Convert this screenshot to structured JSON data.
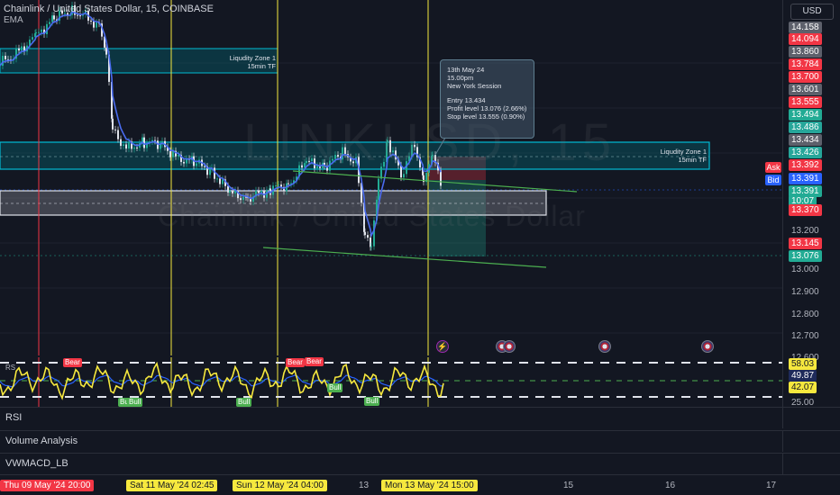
{
  "header": {
    "title": "Chainlink / United States Dollar, 15, COINBASE",
    "ema_label": "EMA"
  },
  "watermark": {
    "symbol": "LINKUSD, 15",
    "name": "Chainlink / United States Dollar"
  },
  "zones": [
    {
      "label_line1": "Liqudity Zone 1",
      "label_line2": "15min TF"
    },
    {
      "label_line1": "Liqudity Zone 1",
      "label_line2": "15min TF"
    }
  ],
  "trade_note": {
    "date": "13th May 24",
    "time": "15.00pm",
    "session": "New York Session",
    "entry": "Entry 13.434",
    "profit": "Profit level 13.076 (2.66%)",
    "stop": "Stop level 13.555 (0.90%)"
  },
  "price_axis": {
    "currency": "USD",
    "ask_label": "Ask",
    "bid_label": "Bid",
    "labels": [
      {
        "text": "14.158",
        "style": "gray"
      },
      {
        "text": "14.094",
        "style": "red"
      },
      {
        "text": "13.860",
        "style": "gray"
      },
      {
        "text": "13.784",
        "style": "red"
      },
      {
        "text": "13.700",
        "style": "red"
      },
      {
        "text": "13.601",
        "style": "gray"
      },
      {
        "text": "13.555",
        "style": "red"
      },
      {
        "text": "13.494",
        "style": "green"
      },
      {
        "text": "13.486",
        "style": "teal"
      },
      {
        "text": "13.434",
        "style": "gray"
      },
      {
        "text": "13.426",
        "style": "teal"
      },
      {
        "text": "13.392",
        "style": "red"
      },
      {
        "text": "13.391",
        "style": "blue"
      },
      {
        "text": "13.391",
        "style": "green"
      },
      {
        "text": "10:07",
        "style": "green"
      },
      {
        "text": "13.370",
        "style": "red"
      },
      {
        "text": "13.200",
        "style": "plain"
      },
      {
        "text": "13.145",
        "style": "red"
      },
      {
        "text": "13.076",
        "style": "green"
      },
      {
        "text": "13.000",
        "style": "plain"
      },
      {
        "text": "12.900",
        "style": "plain"
      },
      {
        "text": "12.800",
        "style": "plain"
      },
      {
        "text": "12.700",
        "style": "plain"
      },
      {
        "text": "12.600",
        "style": "plain"
      },
      {
        "text": "58.03",
        "style": "yellow"
      },
      {
        "text": "49.87",
        "style": "navy"
      },
      {
        "text": "42.07",
        "style": "yellow"
      },
      {
        "text": "25.00",
        "style": "plain"
      }
    ]
  },
  "indicator": {
    "short_label": "RS",
    "bear_label": "Bear",
    "bull_label": "Bull"
  },
  "panels": [
    "RSI",
    "Volume Analysis",
    "VWMACD_LB"
  ],
  "time_axis": [
    {
      "text": "Thu 09 May '24   20:00",
      "style": "red"
    },
    {
      "text": "Sat 11 May '24   02:45",
      "style": "hl"
    },
    {
      "text": "Sun 12 May '24   04:00",
      "style": "hl"
    },
    {
      "text": "13",
      "style": "plain"
    },
    {
      "text": "Mon 13 May '24   15:00",
      "style": "hl"
    },
    {
      "text": "15",
      "style": "plain"
    },
    {
      "text": "16",
      "style": "plain"
    },
    {
      "text": "17",
      "style": "plain"
    }
  ],
  "colors": {
    "background": "#131722",
    "zone_border": "#00bcd4",
    "zone_fill": "#006d7a",
    "green_label": "#22ab94",
    "red_label": "#f23645",
    "gray_label": "#5d606b",
    "blue_label": "#2962ff",
    "teal_label": "#26a69a",
    "yellow_label": "#f6e83e",
    "price_line": "#4a6cf0",
    "trend_line": "#4caf50",
    "vline_yellow": "#f6e83e",
    "vline_red": "#f23645",
    "rsi_line": "#f6e83e",
    "rsi_signal": "#2962ff"
  }
}
